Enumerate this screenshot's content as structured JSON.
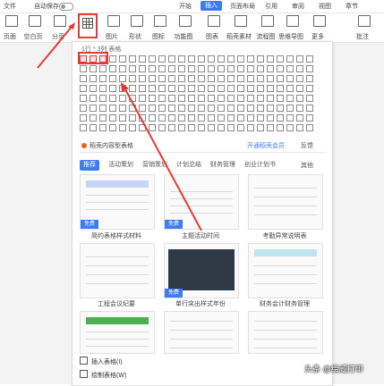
{
  "ribbon_top": {
    "file": "文件",
    "autosave": "自动保存",
    "tabs": [
      "开始",
      "插入",
      "页面布局",
      "引用",
      "审阅",
      "视图",
      "章节"
    ],
    "active_tab": "插入"
  },
  "ribbon": {
    "items": [
      "页面",
      "空白页",
      "分页",
      "图片",
      "形状",
      "图标",
      "功能图",
      "图表",
      "智能图形",
      "稻壳素材",
      "流程图",
      "思维导图",
      "更多",
      "批注"
    ],
    "table_button": "表格"
  },
  "panel": {
    "grid_label": "1行 * 3列 表格",
    "grid_rows": 8,
    "grid_cols": 24,
    "selected_rows": 1,
    "selected_cols": 3,
    "promo": "稻壳内容型表格",
    "vip": "开通稻壳会员",
    "feedback": "反馈",
    "tabs": [
      "推荐",
      "活动策划",
      "营销策划",
      "计划总结",
      "财务管理",
      "创业计划书"
    ],
    "active_tab": "推荐",
    "more": "其他",
    "templates": [
      {
        "title": "简约表格样式材料",
        "free": "免费"
      },
      {
        "title": "主题活动时间",
        "free": "免费"
      },
      {
        "title": "考勤异常说明表",
        "free": ""
      },
      {
        "title": "工程会议纪要",
        "free": ""
      },
      {
        "title": "单行突出样式年份",
        "free": "免费"
      },
      {
        "title": "财务会计财务管理",
        "free": ""
      },
      {
        "title": "",
        "free": ""
      },
      {
        "title": "",
        "free": ""
      },
      {
        "title": "",
        "free": ""
      }
    ],
    "bottom": [
      "插入表格(I)",
      "绘制表格(W)"
    ]
  },
  "watermark": "头条 @绘威打印",
  "colors": {
    "accent": "#3b7cf5",
    "highlight": "#e53935"
  }
}
